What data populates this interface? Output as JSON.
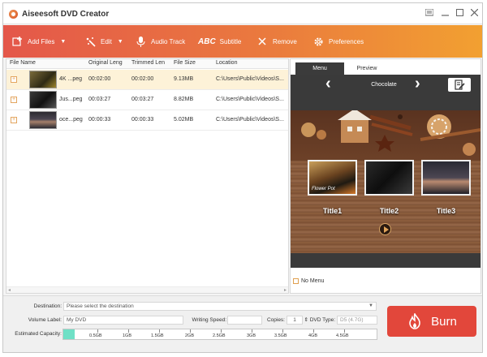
{
  "app": {
    "title": "Aiseesoft DVD Creator"
  },
  "toolbar": {
    "add_files": "Add Files",
    "edit": "Edit",
    "audio_track": "Audio Track",
    "subtitle": "Subtitle",
    "subtitle_icon_text": "ABC",
    "remove": "Remove",
    "preferences": "Preferences"
  },
  "file_list": {
    "columns": [
      "File Name",
      "Original Leng",
      "Trimmed Len",
      "File Size",
      "Location"
    ],
    "rows": [
      {
        "name": "4K ...peg",
        "original": "00:02:00",
        "trimmed": "00:02:00",
        "size": "9.13MB",
        "location": "C:\\Users\\Public\\Videos\\S..."
      },
      {
        "name": "Jus...peg",
        "original": "00:03:27",
        "trimmed": "00:03:27",
        "size": "8.82MB",
        "location": "C:\\Users\\Public\\Videos\\S..."
      },
      {
        "name": "oce...peg",
        "original": "00:00:33",
        "trimmed": "00:00:33",
        "size": "5.02MB",
        "location": "C:\\Users\\Public\\Videos\\S..."
      }
    ]
  },
  "preview_panel": {
    "tab_menu": "Menu",
    "tab_preview": "Preview",
    "theme_name": "Chocolate",
    "thumb_caption": "Flower Pot",
    "titles": [
      "Title1",
      "Title2",
      "Title3"
    ],
    "no_menu": "No Menu"
  },
  "settings": {
    "destination_label": "Destination:",
    "destination_placeholder": "Please select the destination",
    "volume_label": "Volume Label:",
    "volume_value": "My DVD",
    "writing_speed_label": "Writing Speed:",
    "copies_label": "Copies:",
    "copies_value": "1",
    "dvd_type_label": "DVD Type:",
    "dvd_type_value": "D5 (4.7G)",
    "capacity_label": "Estimated Capacity:",
    "capacity_ticks": [
      "0.5GB",
      "1GB",
      "1.5GB",
      "2GB",
      "2.5GB",
      "3GB",
      "3.5GB",
      "4GB",
      "4.5GB"
    ],
    "capacity_used_fraction": 0.035
  },
  "burn": {
    "label": "Burn"
  },
  "colors": {
    "toolbar_start": "#e4574a",
    "toolbar_end": "#f2a031",
    "burn": "#e2473b",
    "selected_row": "#fdf2d8",
    "capacity_fill": "#6fe0c6"
  }
}
